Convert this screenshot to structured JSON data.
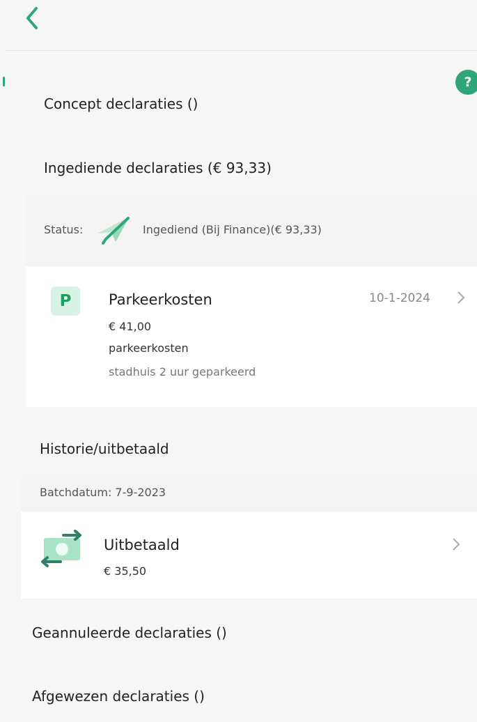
{
  "colors": {
    "accent": "#2fa679",
    "page_bg": "#f6f6f6"
  },
  "header": {
    "back_icon": "chevron-left-icon",
    "help_label": "?"
  },
  "sections": {
    "concept": "Concept declaraties ()",
    "ingediend": "Ingediende declaraties (€ 93,33)",
    "historie": "Historie/uitbetaald",
    "geannuleerd": "Geannuleerde declaraties ()",
    "afgewezen": "Afgewezen declaraties ()"
  },
  "status_row": {
    "prefix": "Status:",
    "icon": "paper-plane-icon",
    "text": "Ingediend (Bij Finance)(€ 93,33)"
  },
  "declaration": {
    "icon_letter": "P",
    "title": "Parkeerkosten",
    "amount": "€ 41,00",
    "category": "parkeerkosten",
    "description": "stadhuis 2 uur geparkeerd",
    "date": "10-1-2024"
  },
  "batch": {
    "label": "Batchdatum: 7-9-2023"
  },
  "payout": {
    "icon": "money-transfer-icon",
    "title": "Uitbetaald",
    "amount": "€ 35,50"
  }
}
